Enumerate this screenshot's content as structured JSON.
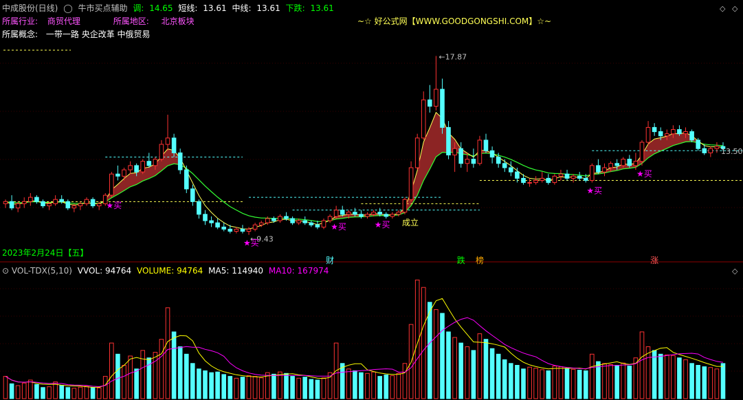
{
  "header": {
    "stock_title": "中成股份(日线)",
    "indicator_name": "牛市买点辅助",
    "labels": [
      {
        "name": "调",
        "value": "14.65",
        "color": "#00ff00"
      },
      {
        "name": "短线",
        "value": "13.61",
        "color": "#ffffff"
      },
      {
        "name": "中线",
        "value": "13.61",
        "color": "#ffffff"
      },
      {
        "name": "下跌",
        "value": "13.61",
        "color": "#00ff00"
      }
    ],
    "industry_label": "所属行业:",
    "industry_value": "商贸代理",
    "region_label": "所属地区:",
    "region_value": "北京板块",
    "concept_label": "所属概念:",
    "concept_value": "一带一路 央企改革 中俄贸易",
    "site_banner": "~☆ 好公式网【WWW.GOODGONGSHI.COM】☆~",
    "date_label": "2023年2月24日【五】"
  },
  "vol_header": {
    "title": "VOL-TDX(5,10)",
    "vvol_label": "VVOL:",
    "vvol_value": "94764",
    "volume_label": "VOLUME:",
    "volume_value": "94764",
    "ma5_label": "MA5:",
    "ma5_value": "114940",
    "ma10_label": "MA10:",
    "ma10_value": "167974"
  },
  "colors": {
    "up": "#ff3232",
    "down": "#54ffff",
    "ma5": "#ffff00",
    "ma10": "#ff00ff",
    "band": "#a52a2a",
    "buy": "#ff00ff"
  },
  "icons": [
    "collapse-icon",
    "close-icon",
    "settings-icon"
  ],
  "chart_data": [
    {
      "type": "candlestick",
      "title": "中成股份(日线)",
      "candles": [
        [
          10.9,
          11.1,
          10.7,
          11.0
        ],
        [
          11.0,
          11.3,
          10.6,
          10.7
        ],
        [
          10.7,
          11.0,
          10.5,
          10.9
        ],
        [
          10.9,
          11.2,
          10.7,
          11.0
        ],
        [
          11.0,
          11.4,
          10.8,
          11.2
        ],
        [
          11.2,
          11.3,
          10.9,
          11.0
        ],
        [
          11.0,
          11.1,
          10.7,
          10.8
        ],
        [
          10.8,
          11.0,
          10.6,
          10.9
        ],
        [
          10.9,
          11.3,
          10.8,
          11.1
        ],
        [
          11.1,
          11.3,
          10.9,
          11.0
        ],
        [
          11.0,
          11.1,
          10.6,
          10.7
        ],
        [
          10.7,
          10.9,
          10.5,
          10.8
        ],
        [
          10.8,
          11.0,
          10.6,
          10.9
        ],
        [
          10.9,
          11.2,
          10.8,
          11.1
        ],
        [
          11.1,
          11.2,
          10.7,
          10.8
        ],
        [
          10.8,
          11.0,
          10.6,
          10.9
        ],
        [
          10.9,
          11.4,
          10.8,
          11.3
        ],
        [
          11.3,
          12.4,
          11.2,
          12.3
        ],
        [
          12.3,
          12.7,
          12.0,
          12.2
        ],
        [
          12.2,
          12.6,
          12.0,
          12.5
        ],
        [
          12.5,
          12.9,
          12.3,
          12.7
        ],
        [
          12.7,
          12.8,
          12.2,
          12.4
        ],
        [
          12.4,
          13.0,
          12.3,
          12.9
        ],
        [
          12.9,
          13.3,
          12.6,
          12.7
        ],
        [
          12.7,
          13.1,
          12.5,
          13.0
        ],
        [
          13.0,
          13.9,
          12.9,
          13.7
        ],
        [
          13.7,
          15.1,
          13.4,
          14.0
        ],
        [
          14.0,
          14.2,
          13.1,
          13.3
        ],
        [
          13.3,
          13.5,
          12.3,
          12.5
        ],
        [
          12.5,
          12.7,
          11.4,
          11.6
        ],
        [
          11.6,
          11.8,
          10.8,
          11.0
        ],
        [
          11.0,
          11.1,
          10.2,
          10.4
        ],
        [
          10.4,
          10.6,
          9.9,
          10.1
        ],
        [
          10.1,
          10.3,
          9.8,
          10.0
        ],
        [
          10.0,
          10.2,
          9.7,
          9.8
        ],
        [
          9.8,
          10.0,
          9.6,
          9.7
        ],
        [
          9.7,
          9.9,
          9.5,
          9.6
        ],
        [
          9.6,
          9.8,
          9.5,
          9.7
        ],
        [
          9.7,
          9.9,
          9.5,
          9.6
        ],
        [
          9.6,
          9.8,
          9.43,
          9.7
        ],
        [
          9.7,
          10.0,
          9.6,
          9.9
        ],
        [
          9.9,
          10.1,
          9.8,
          10.0
        ],
        [
          10.0,
          10.3,
          9.9,
          10.2
        ],
        [
          10.2,
          10.3,
          10.0,
          10.1
        ],
        [
          10.1,
          10.4,
          10.0,
          10.3
        ],
        [
          10.3,
          10.5,
          10.1,
          10.2
        ],
        [
          10.2,
          10.3,
          9.9,
          10.0
        ],
        [
          10.0,
          10.2,
          9.9,
          10.1
        ],
        [
          10.1,
          10.3,
          9.9,
          10.0
        ],
        [
          10.0,
          10.1,
          9.8,
          9.9
        ],
        [
          9.9,
          10.1,
          9.7,
          9.8
        ],
        [
          9.8,
          10.2,
          9.7,
          10.1
        ],
        [
          10.1,
          10.4,
          10.0,
          10.3
        ],
        [
          10.3,
          10.8,
          10.2,
          10.6
        ],
        [
          10.6,
          10.8,
          10.3,
          10.4
        ],
        [
          10.4,
          10.6,
          10.2,
          10.5
        ],
        [
          10.5,
          10.7,
          10.3,
          10.4
        ],
        [
          10.4,
          10.6,
          10.2,
          10.3
        ],
        [
          10.3,
          10.5,
          10.2,
          10.4
        ],
        [
          10.4,
          10.6,
          10.3,
          10.5
        ],
        [
          10.5,
          10.7,
          10.3,
          10.4
        ],
        [
          10.4,
          10.5,
          10.2,
          10.3
        ],
        [
          10.3,
          10.5,
          10.2,
          10.4
        ],
        [
          10.4,
          10.6,
          10.3,
          10.5
        ],
        [
          10.5,
          11.2,
          10.4,
          11.1
        ],
        [
          11.1,
          12.9,
          11.0,
          12.6
        ],
        [
          12.6,
          14.2,
          12.5,
          14.0
        ],
        [
          14.0,
          16.2,
          13.9,
          15.8
        ],
        [
          15.8,
          16.5,
          15.2,
          15.5
        ],
        [
          15.5,
          17.87,
          15.3,
          16.3
        ],
        [
          16.3,
          16.8,
          14.2,
          14.5
        ],
        [
          14.5,
          14.8,
          13.0,
          13.2
        ],
        [
          13.2,
          13.8,
          12.4,
          13.5
        ],
        [
          13.5,
          13.8,
          12.6,
          12.8
        ],
        [
          12.8,
          13.3,
          12.4,
          13.0
        ],
        [
          13.0,
          13.5,
          12.6,
          12.8
        ],
        [
          12.8,
          14.1,
          12.7,
          13.9
        ],
        [
          13.9,
          14.2,
          13.3,
          13.4
        ],
        [
          13.4,
          13.6,
          12.8,
          13.1
        ],
        [
          13.1,
          13.3,
          12.6,
          12.8
        ],
        [
          12.8,
          13.0,
          12.4,
          12.6
        ],
        [
          12.6,
          12.9,
          12.2,
          12.4
        ],
        [
          12.4,
          12.6,
          11.9,
          12.1
        ],
        [
          12.1,
          12.3,
          11.8,
          11.9
        ],
        [
          11.9,
          12.1,
          11.7,
          11.9
        ],
        [
          11.9,
          12.2,
          11.8,
          12.0
        ],
        [
          12.0,
          12.4,
          11.9,
          12.1
        ],
        [
          12.1,
          12.3,
          11.8,
          11.9
        ],
        [
          11.9,
          12.3,
          11.8,
          12.2
        ],
        [
          12.2,
          12.5,
          12.0,
          12.3
        ],
        [
          12.3,
          12.5,
          12.0,
          12.1
        ],
        [
          12.1,
          12.3,
          11.9,
          12.2
        ],
        [
          12.2,
          12.4,
          12.0,
          12.1
        ],
        [
          12.1,
          12.3,
          11.9,
          12.0
        ],
        [
          12.0,
          12.8,
          11.9,
          12.7
        ],
        [
          12.7,
          13.0,
          12.3,
          12.4
        ],
        [
          12.4,
          12.8,
          12.2,
          12.6
        ],
        [
          12.6,
          12.9,
          12.4,
          12.8
        ],
        [
          12.8,
          13.0,
          12.5,
          12.7
        ],
        [
          12.7,
          13.1,
          12.6,
          13.0
        ],
        [
          13.0,
          13.2,
          12.6,
          12.7
        ],
        [
          12.7,
          13.3,
          12.5,
          12.9
        ],
        [
          12.9,
          13.9,
          12.7,
          13.8
        ],
        [
          13.8,
          14.8,
          13.7,
          14.5
        ],
        [
          14.5,
          14.7,
          14.1,
          14.3
        ],
        [
          14.3,
          14.5,
          13.9,
          14.1
        ],
        [
          14.1,
          14.4,
          13.9,
          14.2
        ],
        [
          14.2,
          14.6,
          14.0,
          14.4
        ],
        [
          14.4,
          14.6,
          14.1,
          14.2
        ],
        [
          14.2,
          14.5,
          14.0,
          14.3
        ],
        [
          14.3,
          14.4,
          13.8,
          13.9
        ],
        [
          13.9,
          14.0,
          13.4,
          13.5
        ],
        [
          13.5,
          13.7,
          13.2,
          13.3
        ],
        [
          13.3,
          13.6,
          13.1,
          13.5
        ],
        [
          13.5,
          13.8,
          13.3,
          13.6
        ],
        [
          13.6,
          13.8,
          13.4,
          13.5
        ]
      ],
      "volumes": [
        60000,
        40000,
        35000,
        42000,
        50000,
        38000,
        30000,
        32000,
        45000,
        36000,
        30000,
        28000,
        31000,
        34000,
        30000,
        29000,
        60000,
        150000,
        120000,
        90000,
        115000,
        80000,
        130000,
        110000,
        125000,
        160000,
        245000,
        180000,
        140000,
        120000,
        95000,
        80000,
        75000,
        70000,
        72000,
        65000,
        60000,
        55000,
        58000,
        62000,
        60000,
        56000,
        70000,
        66000,
        72000,
        68000,
        60000,
        55000,
        58000,
        52000,
        50000,
        56000,
        70000,
        150000,
        95000,
        80000,
        75000,
        70000,
        68000,
        72000,
        60000,
        64000,
        62000,
        68000,
        95000,
        200000,
        320000,
        300000,
        260000,
        240000,
        230000,
        180000,
        165000,
        150000,
        140000,
        130000,
        175000,
        160000,
        135000,
        120000,
        105000,
        95000,
        90000,
        80000,
        85000,
        82000,
        78000,
        75000,
        88000,
        86000,
        82000,
        79000,
        77000,
        75000,
        120000,
        100000,
        95000,
        92000,
        90000,
        96000,
        88000,
        110000,
        180000,
        140000,
        130000,
        120000,
        118000,
        116000,
        110000,
        105000,
        95000,
        90000,
        86000,
        84000,
        80000,
        94764
      ],
      "overlays": {
        "ma5_label": "VVOL",
        "ma10_label": "MA10"
      },
      "annotations": [
        {
          "text": "17.87",
          "kind": "high"
        },
        {
          "text": "9.43",
          "kind": "low"
        },
        {
          "text": "13.50",
          "kind": "last"
        },
        {
          "text": "成立",
          "kind": "signal"
        }
      ],
      "buy_signals": [
        {
          "index": 17,
          "text": "★买"
        },
        {
          "index": 39,
          "text": "★买"
        },
        {
          "index": 53,
          "text": "★买"
        },
        {
          "index": 60,
          "text": "★买"
        },
        {
          "index": 94,
          "text": "★买"
        },
        {
          "index": 102,
          "text": "★买"
        }
      ],
      "event_markers": [
        {
          "index": 52,
          "text": "财"
        },
        {
          "index": 73,
          "text": "跌"
        },
        {
          "index": 76,
          "text": "榜"
        },
        {
          "index": 104,
          "text": "涨"
        }
      ],
      "price_range": [
        9.0,
        18.5
      ],
      "volume_range": [
        0,
        330000
      ],
      "grid": true
    }
  ]
}
